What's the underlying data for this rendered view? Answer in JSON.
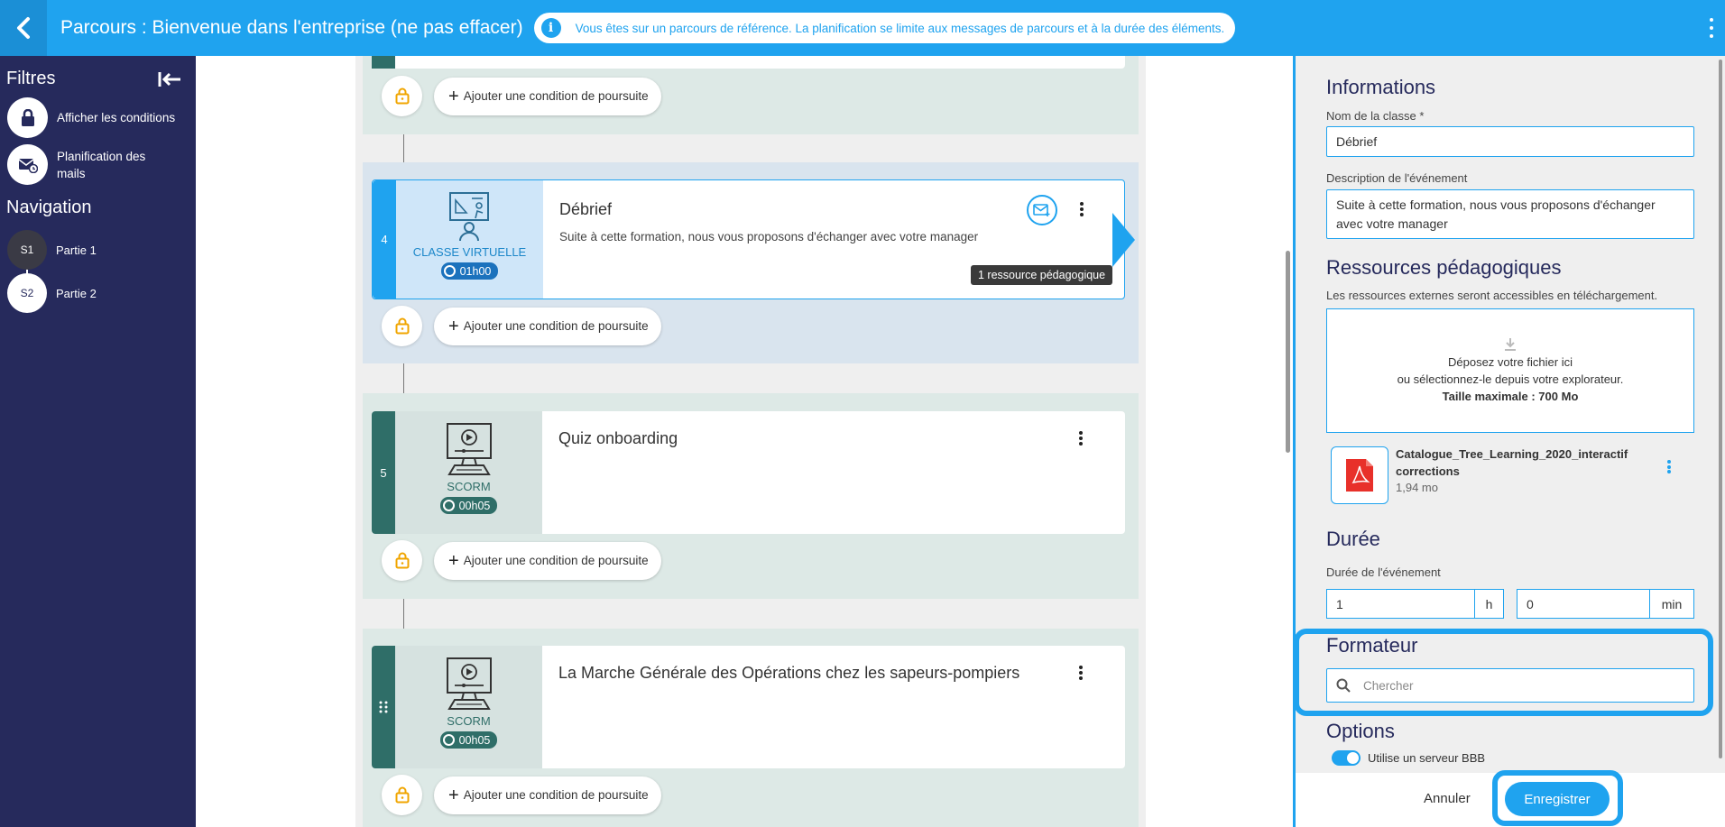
{
  "topbar": {
    "title": "Parcours : Bienvenue dans l'entreprise (ne pas effacer)",
    "info": "Vous êtes sur un parcours de référence. La planification se limite aux messages de parcours et à la durée des éléments.",
    "back_icon": "chevron-left-icon",
    "menu_icon": "kebab-icon"
  },
  "sidebar": {
    "filters_heading": "Filtres",
    "filters": [
      {
        "label": "Afficher les conditions",
        "icon": "lock-icon"
      },
      {
        "label": "Planification des mails",
        "icon": "mail-schedule-icon"
      }
    ],
    "nav_heading": "Navigation",
    "nav": [
      {
        "code": "S1",
        "label": "Partie 1",
        "active": true
      },
      {
        "code": "S2",
        "label": "Partie 2",
        "active": false
      }
    ]
  },
  "main": {
    "condition_label": "Ajouter une condition de poursuite",
    "items": [
      {
        "number": "4",
        "type": "CLASSE VIRTUELLE",
        "duration": "01h00",
        "title": "Débrief",
        "description": "Suite à cette formation, nous vous proposons d'échanger avec votre manager",
        "badge": "1 ressource pédagogique",
        "color": "#1fa3ef"
      },
      {
        "number": "5",
        "type": "SCORM",
        "duration": "00h05",
        "title": "Quiz onboarding",
        "color": "#2f6e68"
      },
      {
        "number": "",
        "type": "SCORM",
        "duration": "00h05",
        "title": "La Marche Générale des Opérations chez les sapeurs-pompiers",
        "color": "#2f6e68"
      }
    ]
  },
  "panel": {
    "info_heading": "Informations",
    "class_name_label": "Nom de la classe *",
    "class_name_value": "Débrief",
    "desc_label": "Description de l'événement",
    "desc_value": "Suite à cette formation, nous vous proposons d'échanger avec votre manager",
    "resources_heading": "Ressources pédagogiques",
    "resources_note": "Les ressources externes seront accessibles en téléchargement.",
    "drop_line1": "Déposez votre fichier ici",
    "drop_line2": "ou sélectionnez-le depuis votre explorateur.",
    "drop_line3": "Taille maximale : 700 Mo",
    "file_name": "Catalogue_Tree_Learning_2020_interactif corrections",
    "file_size": "1,94 mo",
    "duration_heading": "Durée",
    "duration_label": "Durée de l'événement",
    "hours_value": "1",
    "hours_unit": "h",
    "minutes_value": "0",
    "minutes_unit": "min",
    "trainer_heading": "Formateur",
    "trainer_placeholder": "Chercher",
    "options_heading": "Options",
    "bbb_label": "Utilise un serveur BBB",
    "bbb_enabled": true,
    "cancel_label": "Annuler",
    "save_label": "Enregistrer"
  },
  "colors": {
    "accent": "#1fa3ef",
    "sidebar": "#262a5c",
    "scorm": "#2f6e68",
    "lock": "#f0a500"
  }
}
